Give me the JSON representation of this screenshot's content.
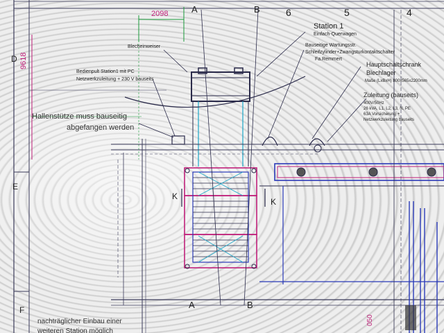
{
  "grid": {
    "top_letters": [
      "A",
      "B"
    ],
    "top_numbers": [
      "6",
      "5",
      "4"
    ],
    "row_letters": [
      "D",
      "E",
      "F"
    ],
    "bottom_letters": [
      "A",
      "B"
    ],
    "section_marks": [
      "K",
      "K"
    ]
  },
  "dimensions": {
    "top_width": "2098",
    "left_height": "9618",
    "bottom_partial": "050"
  },
  "labels": {
    "station_title": "Station 1",
    "station_sub": "Einfach-Querwagen",
    "maintenance_1": "Bauseitige Wartungsstr.",
    "maintenance_2": "Schleifzylinder+Zwangsturkontaktschalter",
    "maintenance_3": "Fa.Remmert",
    "sheet_guide": "Blecheinweiser",
    "control_panel_1": "Bedienpult Station1 mit PC",
    "control_panel_2": "Netzwerkzuleitung + 230 V bauseits",
    "main_cabinet": "Hauptschaltschrank",
    "sheet_storage": "Blechlager",
    "cabinet_size": "Maße (LxBxH) 800x565x2200mm",
    "supply_title": "Zuleitung (bauseits)",
    "supply_1": "400V/50Hz",
    "supply_2": "26 kVA, L1, L2, L3, N, PE",
    "supply_3": "63A Vorsicherung +",
    "supply_4": "Netzwerkzuleitung bauseits",
    "hall_support_1": "Hallenstütze muss bauseitig",
    "hall_support_2": "abgefangen werden",
    "later_station_1": "nachträglicher Einbau einer",
    "later_station_2": "weiteren Station möglich"
  },
  "colors": {
    "line": "#3a3a5a",
    "magenta": "#c0207a",
    "cyan": "#1aa6c8",
    "green": "#1a9a3a",
    "blue": "#2a3ab8"
  }
}
